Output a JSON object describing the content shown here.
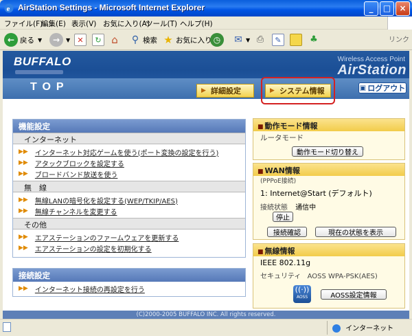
{
  "window": {
    "title": "AirStation Settings - Microsoft Internet Explorer"
  },
  "menu": [
    "ファイル(F)",
    "編集(E)",
    "表示(V)",
    "お気に入り(A)",
    "ツール(T)",
    "ヘルプ(H)"
  ],
  "toolbar": {
    "back": "戻る",
    "search": "検索",
    "favorites": "お気に入り",
    "links": "リンク"
  },
  "header": {
    "logo": "BUFFALO",
    "product_line": "Wireless Access Point",
    "product": "AirStation",
    "page_title": "TOP",
    "tab_advanced": "詳細設定",
    "tab_system": "システム情報",
    "logout": "ログアウト"
  },
  "feature_panel": {
    "title": "機能設定",
    "sections": [
      {
        "label": "インターネット",
        "links": [
          "インターネット対応ゲームを使う(ポート変換の設定を行う)",
          "アタックブロックを設定する",
          "ブロードバンド放送を使う"
        ]
      },
      {
        "label": "無　線",
        "links": [
          "無線LANの暗号化を設定する(WEP/TKIP/AES)",
          "無線チャンネルを変更する"
        ]
      },
      {
        "label": "その他",
        "links": [
          "エアステーションのファームウェアを更新する",
          "エアステーションの設定を初期化する"
        ]
      }
    ]
  },
  "connect_panel": {
    "title": "接続設定",
    "links": [
      "インターネット接続の再設定を行う"
    ]
  },
  "mode_panel": {
    "title": "動作モード情報",
    "mode": "ルータモード",
    "button": "動作モード切り替え"
  },
  "wan_panel": {
    "title": "WAN情報",
    "sub": "(PPPoE接続)",
    "connection": "1: Internet@Start (デフォルト)",
    "status_label": "接続状態",
    "status_value": "通信中",
    "stop_button": "停止",
    "check_button": "接続確認",
    "show_button": "現在の状態を表示"
  },
  "wireless_panel": {
    "title": "無線情報",
    "standard": "IEEE 802.11g",
    "security_label": "セキュリティ",
    "security_value": "AOSS WPA-PSK(AES)",
    "aoss_label": "AOSS",
    "aoss_button": "AOSS設定情報"
  },
  "footer": "(C)2000-2005 BUFFALO INC. All rights reserved.",
  "status": {
    "zone": "インターネット"
  }
}
